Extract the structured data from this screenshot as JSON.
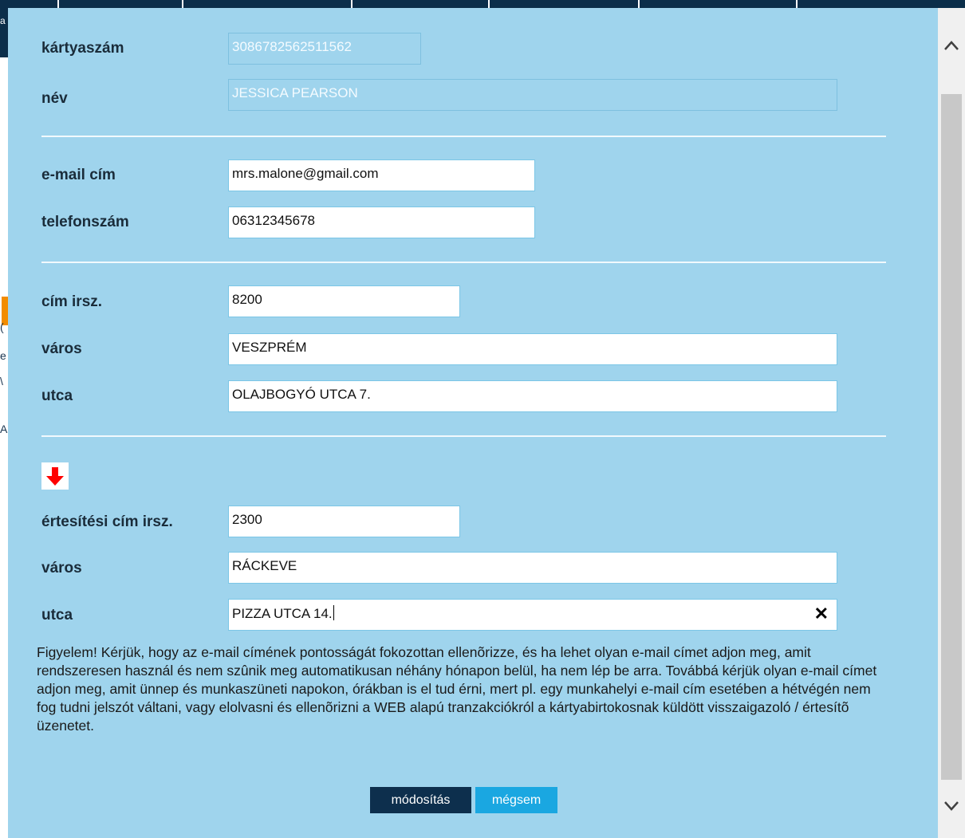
{
  "background_fragments": [
    "a",
    "(",
    "e",
    "\\",
    "A"
  ],
  "account": {
    "card_label": "kártyaszám",
    "card_value": "308678256251156​2",
    "name_label": "név",
    "name_value": "JESSICA PEARSON"
  },
  "contact": {
    "email_label": "e-mail cím",
    "email_value": "mrs.malone@gmail.com",
    "phone_label": "telefonszám",
    "phone_value": "06312345678"
  },
  "address": {
    "zip_label": "cím irsz.",
    "zip_value": "8200",
    "city_label": "város",
    "city_value": "VESZPRÉM",
    "street_label": "utca",
    "street_value": "OLAJBOGYÓ UTCA 7."
  },
  "notification_address": {
    "zip_label": "értesítési cím irsz.",
    "zip_value": "2300",
    "city_label": "város",
    "city_value": "RÁCKEVE",
    "street_label": "utca",
    "street_value": "PIZZA UTCA 14."
  },
  "icons": {
    "copy_arrow": "down-arrow-icon",
    "clear": "close-icon",
    "scroll_up": "chevron-up-icon",
    "scroll_down": "chevron-down-icon"
  },
  "colors": {
    "dialog_bg": "#9fd4ed",
    "primary_button": "#0d2f4d",
    "secondary_button": "#1aa7e1",
    "arrow": "#ff0000"
  },
  "notice": "Figyelem! Kérjük, hogy az e-mail címének pontosságát fokozottan ellenõrizze, és ha lehet olyan e-mail címet adjon meg, amit rendszeresen használ és nem szûnik meg automatikusan néhány hónapon belül, ha nem lép be arra. Továbbá kérjük olyan e-mail címet adjon meg, amit ünnep és munkaszüneti napokon, órákban is el tud érni, mert pl. egy munkahelyi e-mail cím esetében a hétvégén nem fog tudni jelszót váltani, vagy elolvasni és ellenõrizni a WEB alapú tranzakciókról a kártyabirtokosnak küldött visszaigazoló / értesítõ üzenetet.",
  "buttons": {
    "save": "módosítás",
    "cancel": "mégsem"
  }
}
